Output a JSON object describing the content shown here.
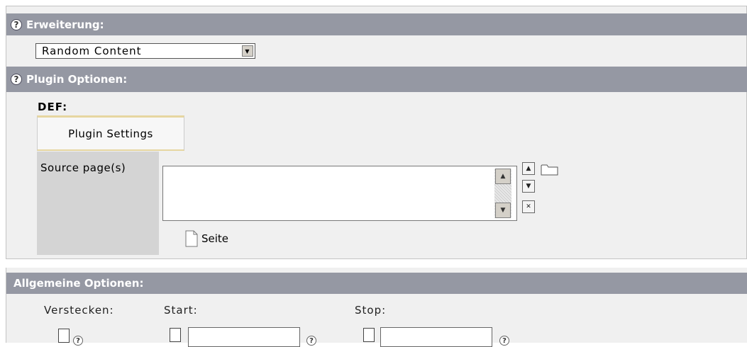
{
  "extension": {
    "title": "Erweiterung:",
    "selected": "Random Content"
  },
  "plugin": {
    "title": "Plugin Optionen:",
    "def_label": "DEF:",
    "tab_label": "Plugin Settings",
    "source_label": "Source page(s)",
    "seite_label": "Seite"
  },
  "general": {
    "title": "Allgemeine Optionen:",
    "hide_label": "Verstecken:",
    "start_label": "Start:",
    "stop_label": "Stop:"
  },
  "icons": {
    "help": "help-icon",
    "folder": "folder-icon",
    "page": "page-icon"
  },
  "colors": {
    "header_bar": "#9598a3",
    "panel_bg": "#f0f0f0",
    "label_col": "#d4d4d4",
    "tab_accent": "#e6d6a0"
  }
}
